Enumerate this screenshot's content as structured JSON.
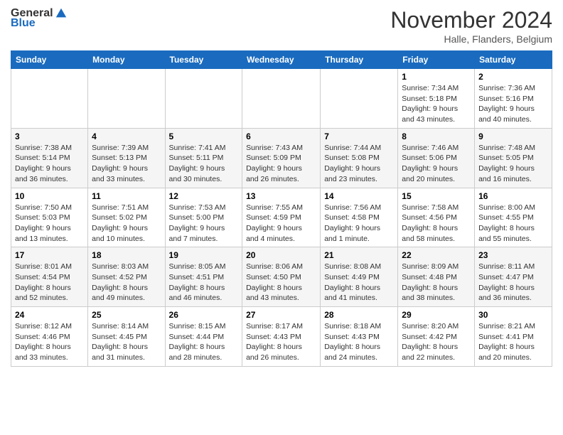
{
  "header": {
    "logo_general": "General",
    "logo_blue": "Blue",
    "month_title": "November 2024",
    "subtitle": "Halle, Flanders, Belgium"
  },
  "days_of_week": [
    "Sunday",
    "Monday",
    "Tuesday",
    "Wednesday",
    "Thursday",
    "Friday",
    "Saturday"
  ],
  "weeks": [
    [
      {
        "day": "",
        "info": ""
      },
      {
        "day": "",
        "info": ""
      },
      {
        "day": "",
        "info": ""
      },
      {
        "day": "",
        "info": ""
      },
      {
        "day": "",
        "info": ""
      },
      {
        "day": "1",
        "info": "Sunrise: 7:34 AM\nSunset: 5:18 PM\nDaylight: 9 hours and 43 minutes."
      },
      {
        "day": "2",
        "info": "Sunrise: 7:36 AM\nSunset: 5:16 PM\nDaylight: 9 hours and 40 minutes."
      }
    ],
    [
      {
        "day": "3",
        "info": "Sunrise: 7:38 AM\nSunset: 5:14 PM\nDaylight: 9 hours and 36 minutes."
      },
      {
        "day": "4",
        "info": "Sunrise: 7:39 AM\nSunset: 5:13 PM\nDaylight: 9 hours and 33 minutes."
      },
      {
        "day": "5",
        "info": "Sunrise: 7:41 AM\nSunset: 5:11 PM\nDaylight: 9 hours and 30 minutes."
      },
      {
        "day": "6",
        "info": "Sunrise: 7:43 AM\nSunset: 5:09 PM\nDaylight: 9 hours and 26 minutes."
      },
      {
        "day": "7",
        "info": "Sunrise: 7:44 AM\nSunset: 5:08 PM\nDaylight: 9 hours and 23 minutes."
      },
      {
        "day": "8",
        "info": "Sunrise: 7:46 AM\nSunset: 5:06 PM\nDaylight: 9 hours and 20 minutes."
      },
      {
        "day": "9",
        "info": "Sunrise: 7:48 AM\nSunset: 5:05 PM\nDaylight: 9 hours and 16 minutes."
      }
    ],
    [
      {
        "day": "10",
        "info": "Sunrise: 7:50 AM\nSunset: 5:03 PM\nDaylight: 9 hours and 13 minutes."
      },
      {
        "day": "11",
        "info": "Sunrise: 7:51 AM\nSunset: 5:02 PM\nDaylight: 9 hours and 10 minutes."
      },
      {
        "day": "12",
        "info": "Sunrise: 7:53 AM\nSunset: 5:00 PM\nDaylight: 9 hours and 7 minutes."
      },
      {
        "day": "13",
        "info": "Sunrise: 7:55 AM\nSunset: 4:59 PM\nDaylight: 9 hours and 4 minutes."
      },
      {
        "day": "14",
        "info": "Sunrise: 7:56 AM\nSunset: 4:58 PM\nDaylight: 9 hours and 1 minute."
      },
      {
        "day": "15",
        "info": "Sunrise: 7:58 AM\nSunset: 4:56 PM\nDaylight: 8 hours and 58 minutes."
      },
      {
        "day": "16",
        "info": "Sunrise: 8:00 AM\nSunset: 4:55 PM\nDaylight: 8 hours and 55 minutes."
      }
    ],
    [
      {
        "day": "17",
        "info": "Sunrise: 8:01 AM\nSunset: 4:54 PM\nDaylight: 8 hours and 52 minutes."
      },
      {
        "day": "18",
        "info": "Sunrise: 8:03 AM\nSunset: 4:52 PM\nDaylight: 8 hours and 49 minutes."
      },
      {
        "day": "19",
        "info": "Sunrise: 8:05 AM\nSunset: 4:51 PM\nDaylight: 8 hours and 46 minutes."
      },
      {
        "day": "20",
        "info": "Sunrise: 8:06 AM\nSunset: 4:50 PM\nDaylight: 8 hours and 43 minutes."
      },
      {
        "day": "21",
        "info": "Sunrise: 8:08 AM\nSunset: 4:49 PM\nDaylight: 8 hours and 41 minutes."
      },
      {
        "day": "22",
        "info": "Sunrise: 8:09 AM\nSunset: 4:48 PM\nDaylight: 8 hours and 38 minutes."
      },
      {
        "day": "23",
        "info": "Sunrise: 8:11 AM\nSunset: 4:47 PM\nDaylight: 8 hours and 36 minutes."
      }
    ],
    [
      {
        "day": "24",
        "info": "Sunrise: 8:12 AM\nSunset: 4:46 PM\nDaylight: 8 hours and 33 minutes."
      },
      {
        "day": "25",
        "info": "Sunrise: 8:14 AM\nSunset: 4:45 PM\nDaylight: 8 hours and 31 minutes."
      },
      {
        "day": "26",
        "info": "Sunrise: 8:15 AM\nSunset: 4:44 PM\nDaylight: 8 hours and 28 minutes."
      },
      {
        "day": "27",
        "info": "Sunrise: 8:17 AM\nSunset: 4:43 PM\nDaylight: 8 hours and 26 minutes."
      },
      {
        "day": "28",
        "info": "Sunrise: 8:18 AM\nSunset: 4:43 PM\nDaylight: 8 hours and 24 minutes."
      },
      {
        "day": "29",
        "info": "Sunrise: 8:20 AM\nSunset: 4:42 PM\nDaylight: 8 hours and 22 minutes."
      },
      {
        "day": "30",
        "info": "Sunrise: 8:21 AM\nSunset: 4:41 PM\nDaylight: 8 hours and 20 minutes."
      }
    ]
  ]
}
